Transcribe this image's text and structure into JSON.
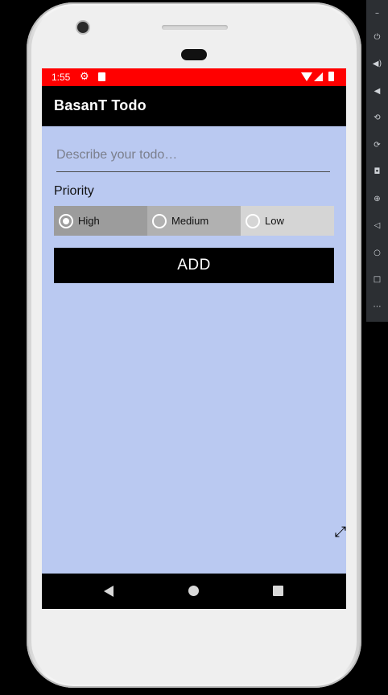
{
  "status_bar": {
    "time": "1:55",
    "background": "#ff0000",
    "icons": [
      "gear-icon",
      "sd-card-icon",
      "wifi-icon",
      "signal-icon",
      "battery-icon"
    ]
  },
  "app_bar": {
    "title": "BasanT Todo",
    "background": "#000000"
  },
  "form": {
    "todo_placeholder": "Describe your todo…",
    "todo_value": "",
    "priority_label": "Priority",
    "priorities": [
      {
        "label": "High",
        "selected": true
      },
      {
        "label": "Medium",
        "selected": false
      },
      {
        "label": "Low",
        "selected": false
      }
    ],
    "add_label": "ADD"
  },
  "colors": {
    "screen_background": "#bac9f1",
    "high_bg": "#9c9c9c",
    "medium_bg": "#b1b1b1",
    "low_bg": "#d5d5d5"
  },
  "nav_bar": {
    "icons": [
      "back-icon",
      "home-icon",
      "recents-icon"
    ]
  },
  "emulator_toolbar": {
    "icons": [
      "minimize-icon",
      "power-icon",
      "volume-up-icon",
      "volume-down-icon",
      "rotate-left-icon",
      "rotate-right-icon",
      "camera-icon",
      "zoom-icon",
      "back-icon",
      "home-icon",
      "overview-icon",
      "more-icon"
    ]
  }
}
